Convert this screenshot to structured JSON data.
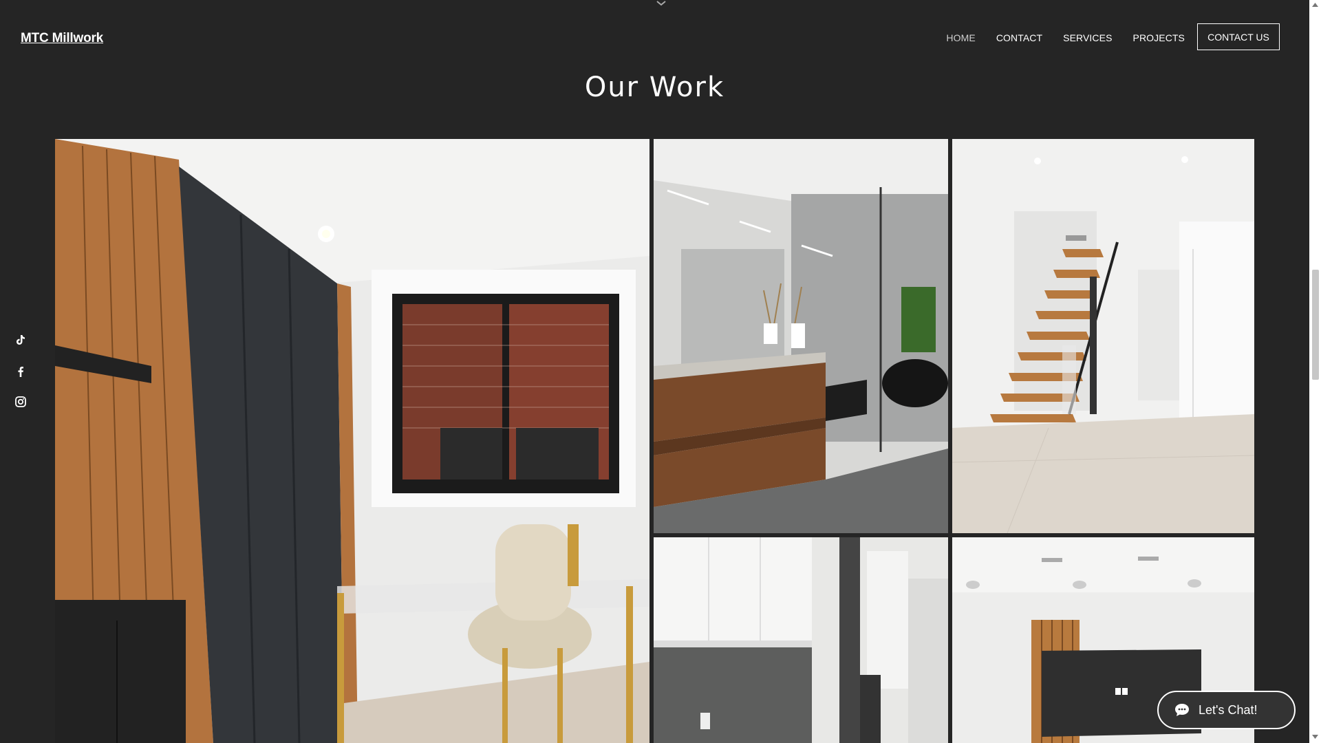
{
  "header": {
    "logo": "MTC Millwork",
    "nav": [
      "HOME",
      "CONTACT",
      "SERVICES",
      "PROJECTS"
    ],
    "cta": "CONTACT US"
  },
  "section": {
    "title": "Our Work"
  },
  "social": [
    "tiktok-icon",
    "facebook-icon",
    "instagram-icon"
  ],
  "gallery": [
    "home-office-photo",
    "bathroom-vanity-photo",
    "staircase-photo",
    "kitchen-photo",
    "living-room-photo"
  ],
  "chat": {
    "label": "Let's Chat!"
  },
  "colors": {
    "background": "#252525",
    "text": "#ffffff",
    "nav_active": "#cfcfcf"
  }
}
